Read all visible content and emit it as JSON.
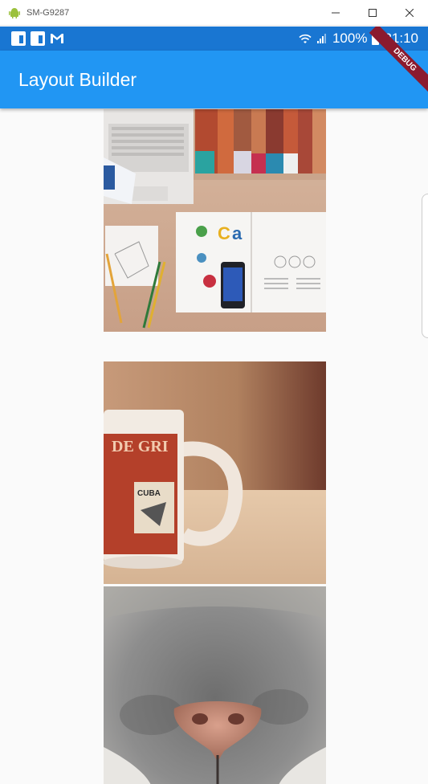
{
  "window": {
    "device_title": "SM-G9287",
    "icons": [
      "android-icon",
      "minimize-icon",
      "maximize-icon",
      "close-icon"
    ]
  },
  "status_bar": {
    "battery": "100%",
    "time": "21:10",
    "icons": [
      "flipboard-icon",
      "flipboard-icon",
      "gmail-icon",
      "wifi-icon",
      "signal-icon",
      "battery-icon"
    ]
  },
  "app_bar": {
    "title": "Layout Builder"
  },
  "debug_banner": {
    "label": "DEBUG"
  },
  "images": [
    {
      "subject": "desk-workspace-photo"
    },
    {
      "subject": "coffee-mug-photo"
    },
    {
      "subject": "cat-nose-photo"
    }
  ],
  "colors": {
    "status_bar": "#1976d2",
    "app_bar": "#2196f3",
    "debug_ribbon": "#8b1a2e",
    "background": "#fafafa"
  }
}
